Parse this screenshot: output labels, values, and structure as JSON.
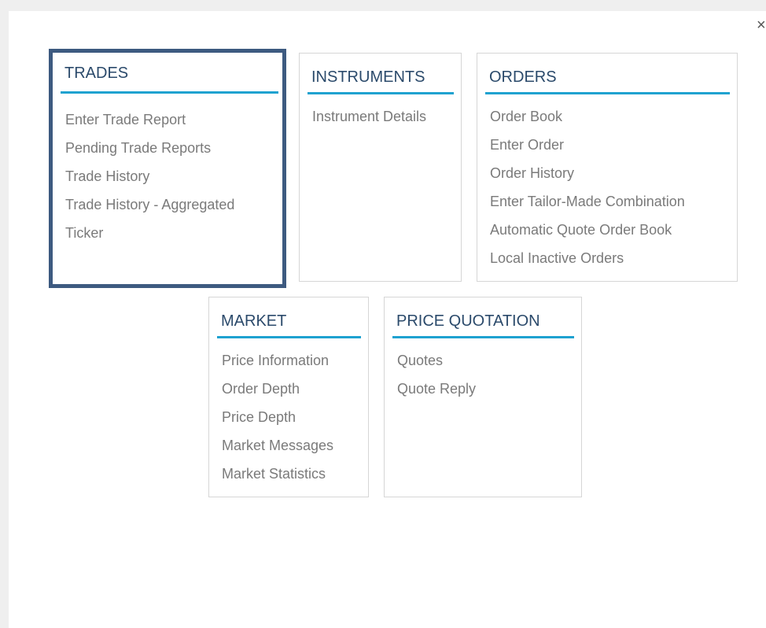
{
  "dialog": {
    "close_symbol": "×"
  },
  "colors": {
    "background": "#efefef",
    "panel": "#ffffff",
    "title": "#2b4a6b",
    "accent_rule": "#1fa2d0",
    "item_text": "#7a7a7a",
    "selection_border": "#3d5a80",
    "card_border": "#d6d6d6"
  },
  "menu": {
    "trades": {
      "title": "TRADES",
      "selected": true,
      "items": [
        "Enter Trade Report",
        "Pending Trade Reports",
        "Trade History",
        "Trade History - Aggregated",
        "Ticker"
      ]
    },
    "instruments": {
      "title": "INSTRUMENTS",
      "selected": false,
      "items": [
        "Instrument Details"
      ]
    },
    "orders": {
      "title": "ORDERS",
      "selected": false,
      "items": [
        "Order Book",
        "Enter Order",
        "Order History",
        "Enter Tailor-Made Combination",
        "Automatic Quote Order Book",
        "Local Inactive Orders"
      ]
    },
    "market": {
      "title": "MARKET",
      "selected": false,
      "items": [
        "Price Information",
        "Order Depth",
        "Price Depth",
        "Market Messages",
        "Market Statistics"
      ]
    },
    "price_quotation": {
      "title": "PRICE QUOTATION",
      "selected": false,
      "items": [
        "Quotes",
        "Quote Reply"
      ]
    }
  }
}
